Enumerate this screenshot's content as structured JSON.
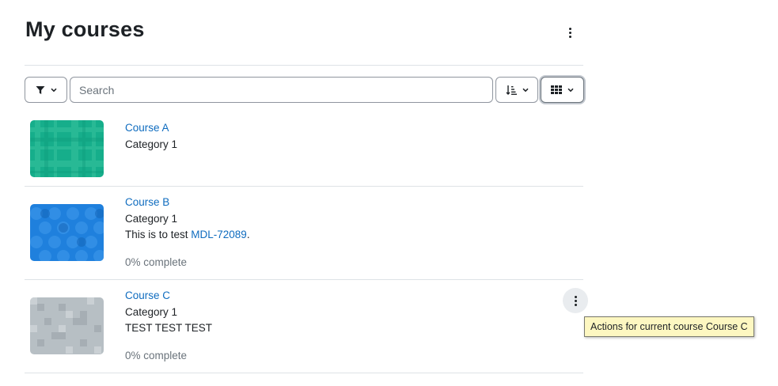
{
  "page": {
    "title": "My courses",
    "menu_icon": "kebab-vertical-icon"
  },
  "toolbar": {
    "filter_icon": "filter-icon",
    "search_placeholder": "Search",
    "search_value": "",
    "sort_icon": "sort-icon",
    "view_icon": "grid-view-icon"
  },
  "courses": [
    {
      "name": "Course A",
      "category": "Category 1",
      "summary": "",
      "progress": "",
      "image_color": "#16ae8b"
    },
    {
      "name": "Course B",
      "category": "Category 1",
      "summary_prefix": "This is to test ",
      "summary_link": "MDL-72089",
      "summary_suffix": ".",
      "progress": "0% complete",
      "image_color": "#1f80dd"
    },
    {
      "name": "Course C",
      "category": "Category 1",
      "summary": "TEST TEST TEST",
      "progress": "0% complete",
      "image_color": "#b7bfc4"
    }
  ],
  "course_actions": {
    "icon": "kebab-vertical-icon",
    "tooltip": "Actions for current course Course C"
  },
  "colors": {
    "link": "#0f6cbf",
    "text": "#1d2125",
    "muted": "#6a737b",
    "tooltip_bg": "#fdf7c1"
  }
}
